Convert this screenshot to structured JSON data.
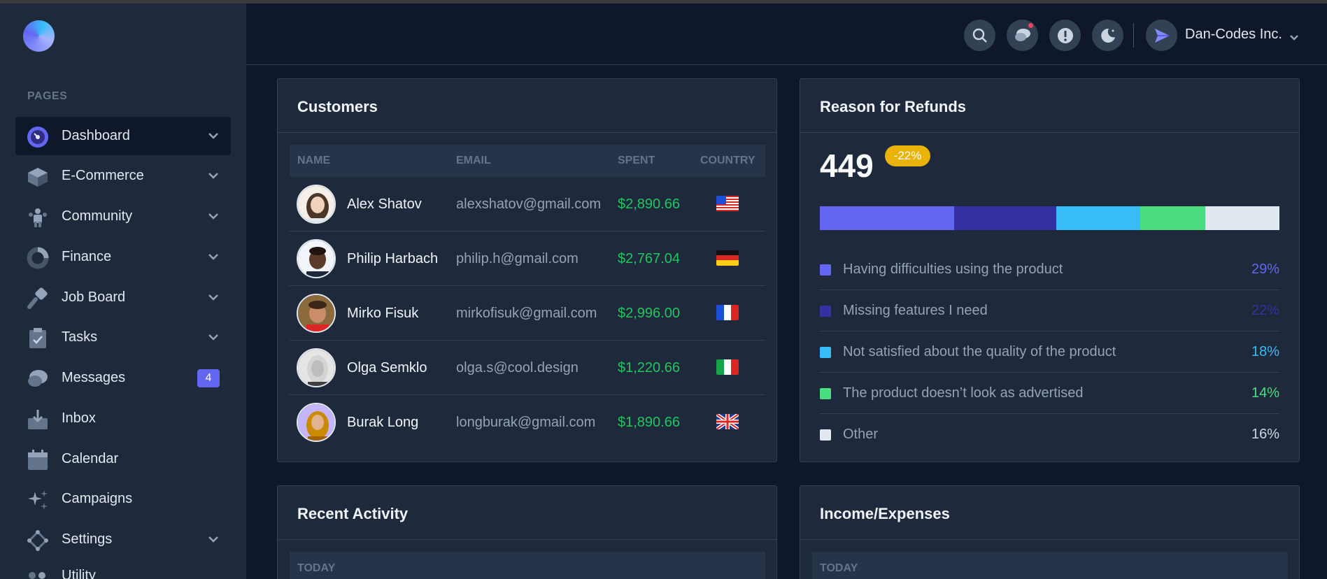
{
  "sidebar": {
    "section_label": "PAGES",
    "items": [
      {
        "label": "Dashboard",
        "icon": "dashboard-icon",
        "chevron": true,
        "active": true
      },
      {
        "label": "E-Commerce",
        "icon": "ecommerce-icon",
        "chevron": true
      },
      {
        "label": "Community",
        "icon": "community-icon",
        "chevron": true
      },
      {
        "label": "Finance",
        "icon": "finance-icon",
        "chevron": true
      },
      {
        "label": "Job Board",
        "icon": "job-board-icon",
        "chevron": true
      },
      {
        "label": "Tasks",
        "icon": "tasks-icon",
        "chevron": true
      },
      {
        "label": "Messages",
        "icon": "messages-icon",
        "badge": "4"
      },
      {
        "label": "Inbox",
        "icon": "inbox-icon"
      },
      {
        "label": "Calendar",
        "icon": "calendar-icon"
      },
      {
        "label": "Campaigns",
        "icon": "campaigns-icon"
      },
      {
        "label": "Settings",
        "icon": "settings-icon",
        "chevron": true
      },
      {
        "label": "Utility",
        "icon": "utility-icon"
      }
    ]
  },
  "header": {
    "user_name": "Dan-Codes Inc.",
    "buttons": [
      "search-icon",
      "chat-icon",
      "info-icon",
      "moon-icon"
    ]
  },
  "customers": {
    "title": "Customers",
    "columns": [
      "NAME",
      "EMAIL",
      "SPENT",
      "COUNTRY"
    ],
    "rows": [
      {
        "name": "Alex Shatov",
        "email": "alexshatov@gmail.com",
        "spent": "$2,890.66",
        "flag": "us-flag-icon"
      },
      {
        "name": "Philip Harbach",
        "email": "philip.h@gmail.com",
        "spent": "$2,767.04",
        "flag": "de-flag-icon"
      },
      {
        "name": "Mirko Fisuk",
        "email": "mirkofisuk@gmail.com",
        "spent": "$2,996.00",
        "flag": "fr-flag-icon"
      },
      {
        "name": "Olga Semklo",
        "email": "olga.s@cool.design",
        "spent": "$1,220.66",
        "flag": "it-flag-icon"
      },
      {
        "name": "Burak Long",
        "email": "longburak@gmail.com",
        "spent": "$1,890.66",
        "flag": "gb-flag-icon"
      }
    ]
  },
  "refunds": {
    "title": "Reason for Refunds",
    "total": "449",
    "change": "-22%",
    "reasons": [
      {
        "label": "Having difficulties using the product",
        "pct": "29%",
        "value": 29,
        "color": "#6366f1"
      },
      {
        "label": "Missing features I need",
        "pct": "22%",
        "value": 22,
        "color": "#3730a3"
      },
      {
        "label": "Not satisfied about the quality of the product",
        "pct": "18%",
        "value": 18,
        "color": "#38bdf8"
      },
      {
        "label": "The product doesn’t look as advertised",
        "pct": "14%",
        "value": 14,
        "color": "#4ade80"
      },
      {
        "label": "Other",
        "pct": "16%",
        "value": 16,
        "color": "#e2e8f0"
      }
    ]
  },
  "recent_activity": {
    "title": "Recent Activity",
    "group_label": "TODAY"
  },
  "income_expenses": {
    "title": "Income/Expenses",
    "group_label": "TODAY"
  }
}
